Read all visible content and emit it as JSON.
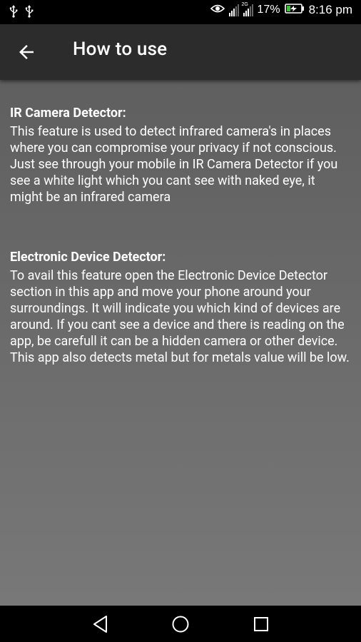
{
  "status_bar": {
    "battery": "17%",
    "time": "8:16 pm",
    "sim2_label": "2G"
  },
  "app_bar": {
    "title": "How to use"
  },
  "sections": [
    {
      "title": "IR Camera Detector:",
      "body": "This feature is used to detect infrared camera's in places where you can compromise your privacy if not conscious. Just see through your mobile in IR Camera Detector if you see a white light which you cant see with naked eye, it might be an infrared camera"
    },
    {
      "title": "Electronic Device Detector:",
      "body": "To avail this feature open the Electronic Device Detector section in this app and move your phone around your surroundings. It will indicate you which kind of devices are around. If you cant see a device and there is reading on the app, be carefull it can be a hidden camera or other device.\nThis app also detects metal but for metals value will be low."
    }
  ],
  "icons": {
    "usb": "usb-icon",
    "eye": "eye-icon",
    "battery": "battery-charging-icon",
    "back": "arrow-back-icon",
    "nav_back": "nav-back-icon",
    "nav_home": "nav-home-icon",
    "nav_recents": "nav-recents-icon"
  }
}
